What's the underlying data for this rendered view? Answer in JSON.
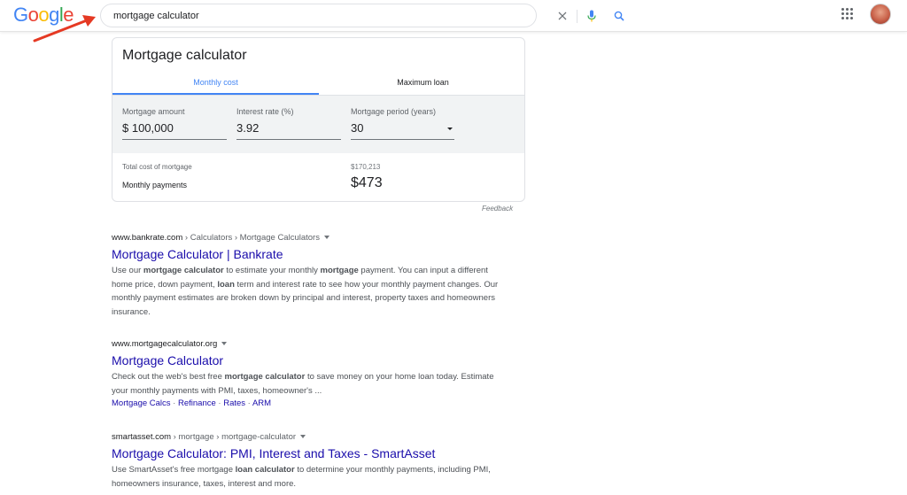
{
  "header": {
    "logo": [
      "G",
      "o",
      "o",
      "g",
      "l",
      "e"
    ],
    "logo_colors": [
      "#4285F4",
      "#EA4335",
      "#FBBC05",
      "#4285F4",
      "#34A853",
      "#EA4335"
    ],
    "search_query": "mortgage calculator",
    "icons": [
      "clear-icon",
      "mic-icon",
      "search-icon",
      "apps-icon",
      "avatar"
    ],
    "annotation_arrow_color": "#E53923"
  },
  "calculator": {
    "title": "Mortgage calculator",
    "tabs": [
      "Monthly cost",
      "Maximum loan"
    ],
    "fields": {
      "amount_label": "Mortgage amount",
      "amount_value": "$ 100,000",
      "rate_label": "Interest rate (%)",
      "rate_value": "3.92",
      "period_label": "Mortgage period (years)",
      "period_value": "30"
    },
    "results": {
      "total_label": "Total cost of mortgage",
      "total_value": "$170,213",
      "monthly_label": "Monthly payments",
      "monthly_value": "$473"
    },
    "feedback": "Feedback"
  },
  "results": [
    {
      "site": "www.bankrate.com",
      "path": " › Calculators › Mortgage Calculators",
      "title": "Mortgage Calculator | Bankrate",
      "snippet": [
        {
          "t": "Use our ",
          "b": false
        },
        {
          "t": "mortgage calculator",
          "b": true
        },
        {
          "t": " to estimate your monthly ",
          "b": false
        },
        {
          "t": "mortgage",
          "b": true
        },
        {
          "t": " payment. You can input a different home price, down payment, ",
          "b": false
        },
        {
          "t": "loan",
          "b": true
        },
        {
          "t": " term and interest rate to see how your monthly payment changes. Our monthly payment estimates are broken down by principal and interest, property taxes and homeowners insurance.",
          "b": false
        }
      ]
    },
    {
      "site": "www.mortgagecalculator.org",
      "path": "",
      "title": "Mortgage Calculator",
      "snippet": [
        {
          "t": "Check out the web's best free ",
          "b": false
        },
        {
          "t": "mortgage calculator",
          "b": true
        },
        {
          "t": " to save money on your home loan today. Estimate your monthly payments with PMI, taxes, homeowner's ...",
          "b": false
        }
      ],
      "sitelinks": [
        "Mortgage Calcs",
        "Refinance",
        "Rates",
        "ARM"
      ]
    },
    {
      "site": "smartasset.com",
      "path": " › mortgage › mortgage-calculator",
      "title": "Mortgage Calculator: PMI, Interest and Taxes - SmartAsset",
      "snippet": [
        {
          "t": "Use SmartAsset's free mortgage ",
          "b": false
        },
        {
          "t": "loan calculator",
          "b": true
        },
        {
          "t": " to determine your monthly payments, including PMI, homeowners insurance, taxes, interest and more.",
          "b": false
        }
      ]
    }
  ]
}
